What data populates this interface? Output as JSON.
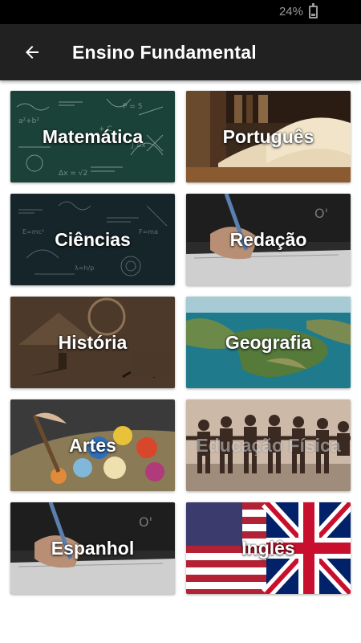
{
  "status_bar": {
    "battery_text": "24%",
    "battery_level": 0.24,
    "icon": "battery-icon"
  },
  "app_bar": {
    "title": "Ensino Fundamental",
    "back_icon": "arrow-left-icon"
  },
  "subjects": [
    {
      "label": "Matemática"
    },
    {
      "label": "Português"
    },
    {
      "label": "Ciências"
    },
    {
      "label": "Redação"
    },
    {
      "label": "História"
    },
    {
      "label": "Geografia"
    },
    {
      "label": "Artes"
    },
    {
      "label": "Educação Física"
    },
    {
      "label": "Espanhol"
    },
    {
      "label": "Inglês"
    }
  ]
}
